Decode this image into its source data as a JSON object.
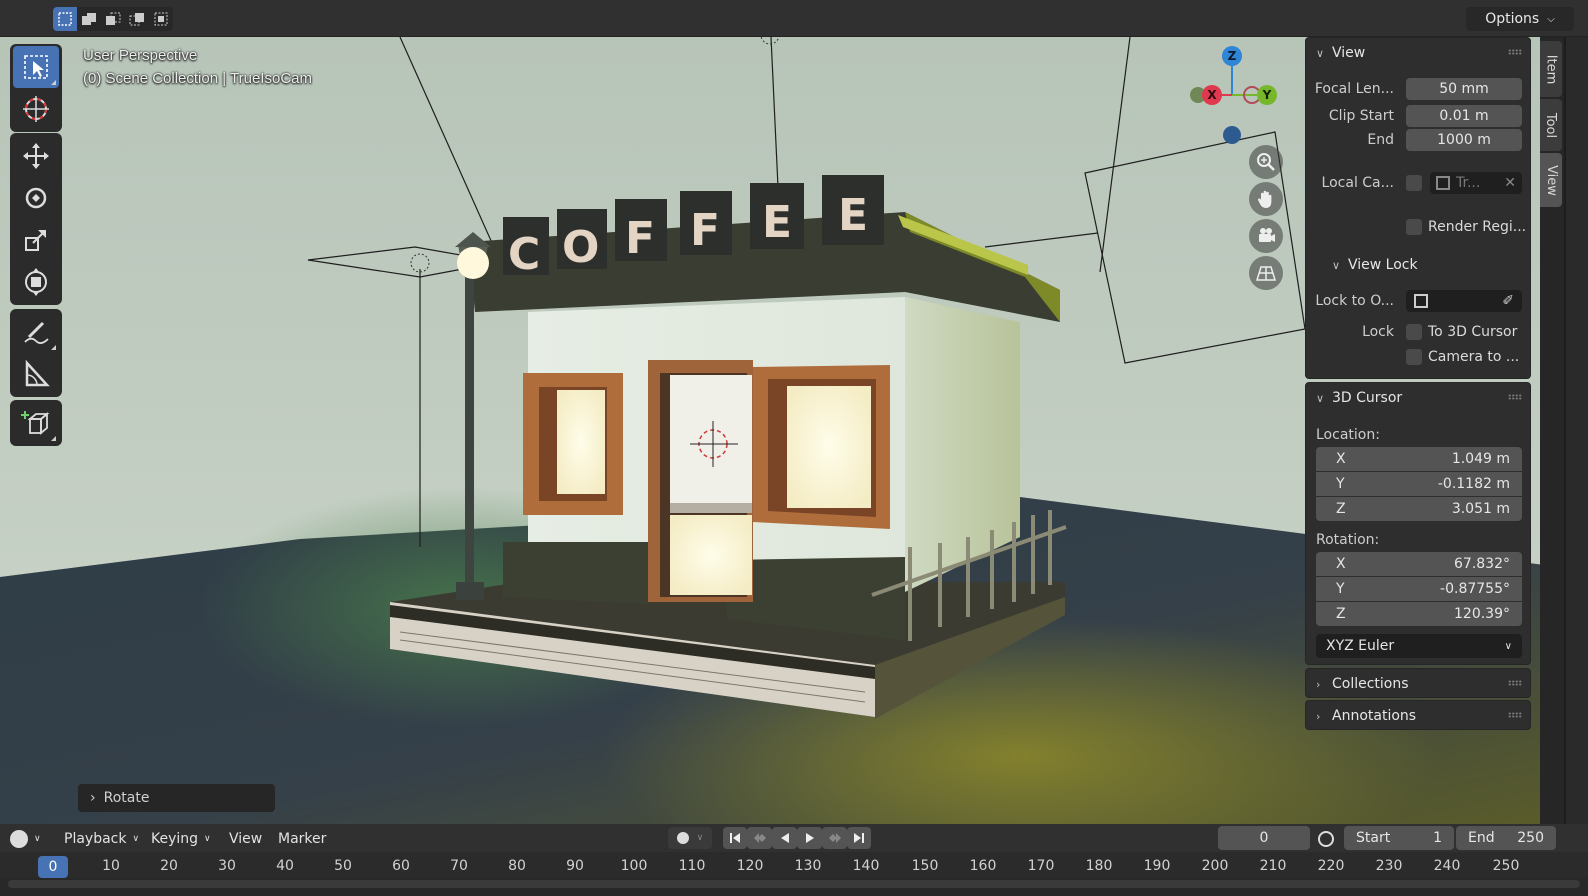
{
  "header": {
    "select_modes": [
      "select-new-icon",
      "select-extend-icon",
      "select-subtract-icon",
      "select-invert-icon",
      "select-intersect-icon"
    ],
    "options_label": "Options"
  },
  "viewport": {
    "perspective_label": "User Perspective",
    "collection_label": "(0) Scene Collection | TrueIsoCam",
    "sign_letters": [
      "C",
      "O",
      "F",
      "F",
      "E",
      "E"
    ],
    "gizmo_axes": {
      "z": "Z",
      "x": "X",
      "y": "Y"
    },
    "colors": {
      "axis_x": "#e0384e",
      "axis_y": "#76b72c",
      "axis_z": "#2f85d6",
      "selection_blue": "#4772b3"
    }
  },
  "toolbar": {
    "tools": [
      "select-box-icon",
      "cursor-icon",
      "move-icon",
      "rotate-icon",
      "scale-icon",
      "transform-icon",
      "annotate-icon",
      "measure-icon",
      "add-cube-icon"
    ]
  },
  "sidebar": {
    "tabs": [
      "Item",
      "Tool",
      "View"
    ],
    "view_panel": {
      "title": "View",
      "focal_length_label": "Focal Len...",
      "focal_length_value": "50 mm",
      "clip_start_label": "Clip Start",
      "clip_start_value": "0.01 m",
      "clip_end_label": "End",
      "clip_end_value": "1000 m",
      "local_camera_label": "Local Ca...",
      "local_camera_value": "Tr...",
      "render_region_label": "Render Regi...",
      "view_lock_title": "View Lock",
      "lock_to_object_label": "Lock to O...",
      "lock_label": "Lock",
      "lock_cursor_label": "To 3D Cursor",
      "camera_to_view_label": "Camera to ..."
    },
    "cursor_panel": {
      "title": "3D Cursor",
      "location_label": "Location:",
      "location": [
        {
          "axis": "X",
          "value": "1.049 m"
        },
        {
          "axis": "Y",
          "value": "-0.1182 m"
        },
        {
          "axis": "Z",
          "value": "3.051 m"
        }
      ],
      "rotation_label": "Rotation:",
      "rotation": [
        {
          "axis": "X",
          "value": "67.832°"
        },
        {
          "axis": "Y",
          "value": "-0.87755°"
        },
        {
          "axis": "Z",
          "value": "120.39°"
        }
      ],
      "rotation_mode": "XYZ Euler"
    },
    "collections_title": "Collections",
    "annotations_title": "Annotations"
  },
  "operator_panel": {
    "label": "Rotate"
  },
  "timeline": {
    "menus": [
      "Playback",
      "Keying",
      "View",
      "Marker"
    ],
    "current_frame": "0",
    "start_label": "Start",
    "start_value": "1",
    "end_label": "End",
    "end_value": "250",
    "ruler_current": "0",
    "ruler_ticks": [
      "10",
      "20",
      "30",
      "40",
      "50",
      "60",
      "70",
      "80",
      "90",
      "100",
      "110",
      "120",
      "130",
      "140",
      "150",
      "160",
      "170",
      "180",
      "190",
      "200",
      "210",
      "220",
      "230",
      "240",
      "250"
    ]
  }
}
